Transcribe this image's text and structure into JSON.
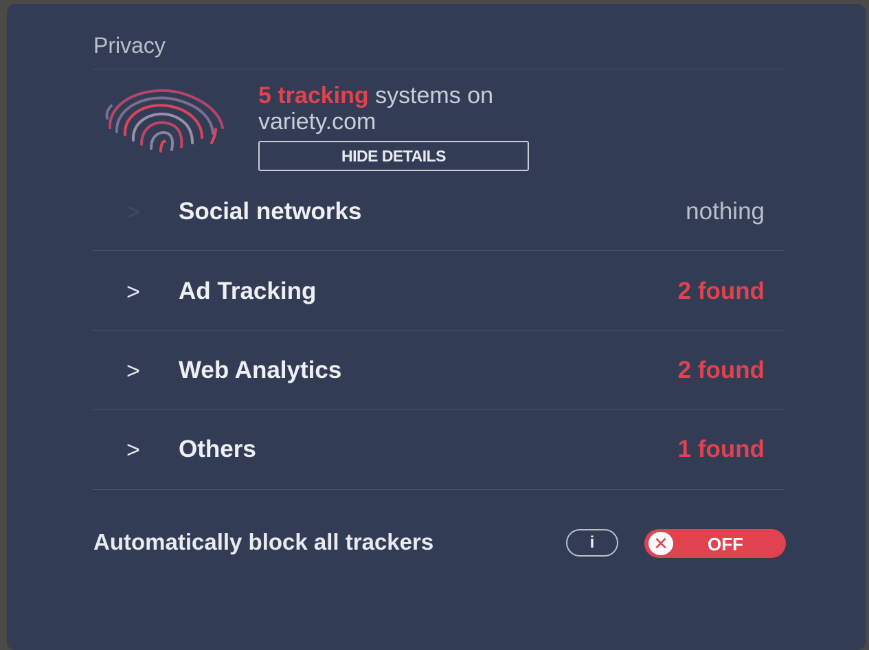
{
  "privacy": {
    "title": "Privacy",
    "summary": {
      "count_text": "5 tracking",
      "rest_text": " systems on",
      "domain": "variety.com"
    },
    "hide_details_label": "HIDE DETAILS",
    "categories": [
      {
        "label": "Social networks",
        "status": "nothing",
        "chevron": ">"
      },
      {
        "label": "Ad Tracking",
        "status": "2 found",
        "chevron": ">"
      },
      {
        "label": "Web Analytics",
        "status": "2 found",
        "chevron": ">"
      },
      {
        "label": "Others",
        "status": "1 found",
        "chevron": ">"
      }
    ],
    "auto_block": {
      "label": "Automatically block all trackers",
      "info_icon": "i",
      "toggle_knob": "✕",
      "toggle_state": "OFF"
    }
  },
  "colors": {
    "background": "#323d55",
    "accent_red": "#e0424f",
    "text_light": "#eef0f4",
    "text_muted": "#b9c0cc"
  },
  "icons": {
    "fingerprint": "fingerprint-icon",
    "chevron": "chevron-right-icon",
    "info": "info-icon",
    "close": "close-icon"
  }
}
